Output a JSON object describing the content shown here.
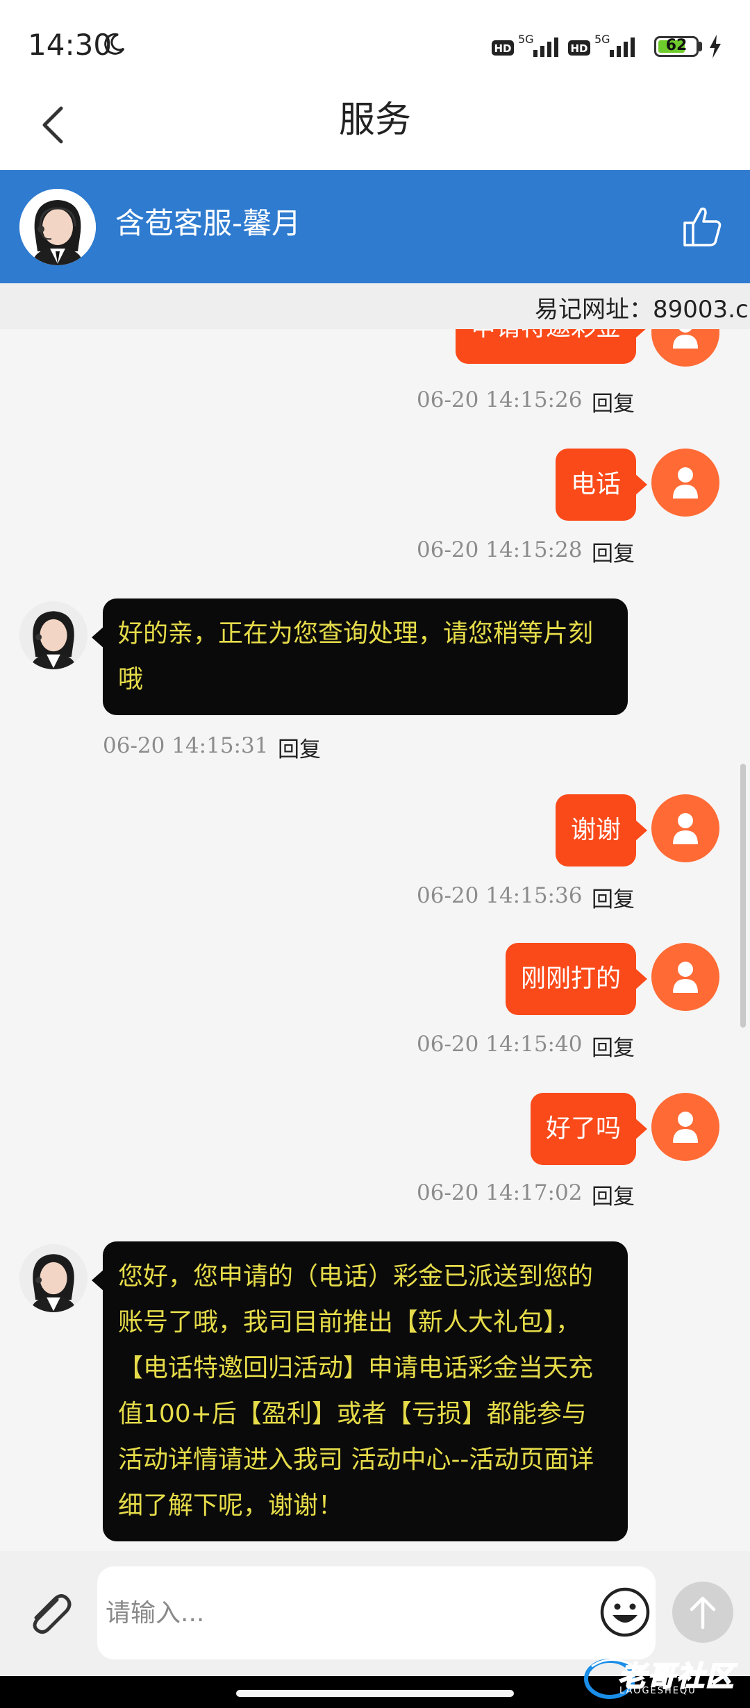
{
  "status": {
    "time": "14:30",
    "signal1": "5G",
    "signal2": "5G",
    "hd": "HD",
    "battery": "62"
  },
  "nav": {
    "title": "服务"
  },
  "agent": {
    "name": "含苞客服-馨月"
  },
  "notice": {
    "text": "易记网址：89003.c"
  },
  "messages": {
    "m0": {
      "text": "申请特邀彩金",
      "time": "06-20 14:15:26",
      "reply": "回复"
    },
    "m1": {
      "text": "电话",
      "time": "06-20 14:15:28",
      "reply": "回复"
    },
    "m2": {
      "text": "好的亲，正在为您查询处理，请您稍等片刻哦",
      "time": "06-20 14:15:31",
      "reply": "回复"
    },
    "m3": {
      "text": "谢谢",
      "time": "06-20 14:15:36",
      "reply": "回复"
    },
    "m4": {
      "text": "刚刚打的",
      "time": "06-20 14:15:40",
      "reply": "回复"
    },
    "m5": {
      "text": "好了吗",
      "time": "06-20 14:17:02",
      "reply": "回复"
    },
    "m6": {
      "text": "您好，您申请的（电话）彩金已派送到您的账号了哦，我司目前推出【新人大礼包】，【电话特邀回归活动】申请电话彩金当天充值100+后【盈利】或者【亏损】都能参与 活动详情请进入我司 活动中心--活动页面详细了解下呢，谢谢！"
    }
  },
  "input": {
    "placeholder": "请输入..."
  },
  "watermark": {
    "text": "老哥社区",
    "sub": "LAOGESHEQU"
  },
  "colors": {
    "header": "#2e7bd0",
    "user_bubble": "#fa4a1a",
    "agent_bubble": "#0a0a0a",
    "agent_text": "#e6dc4a"
  }
}
